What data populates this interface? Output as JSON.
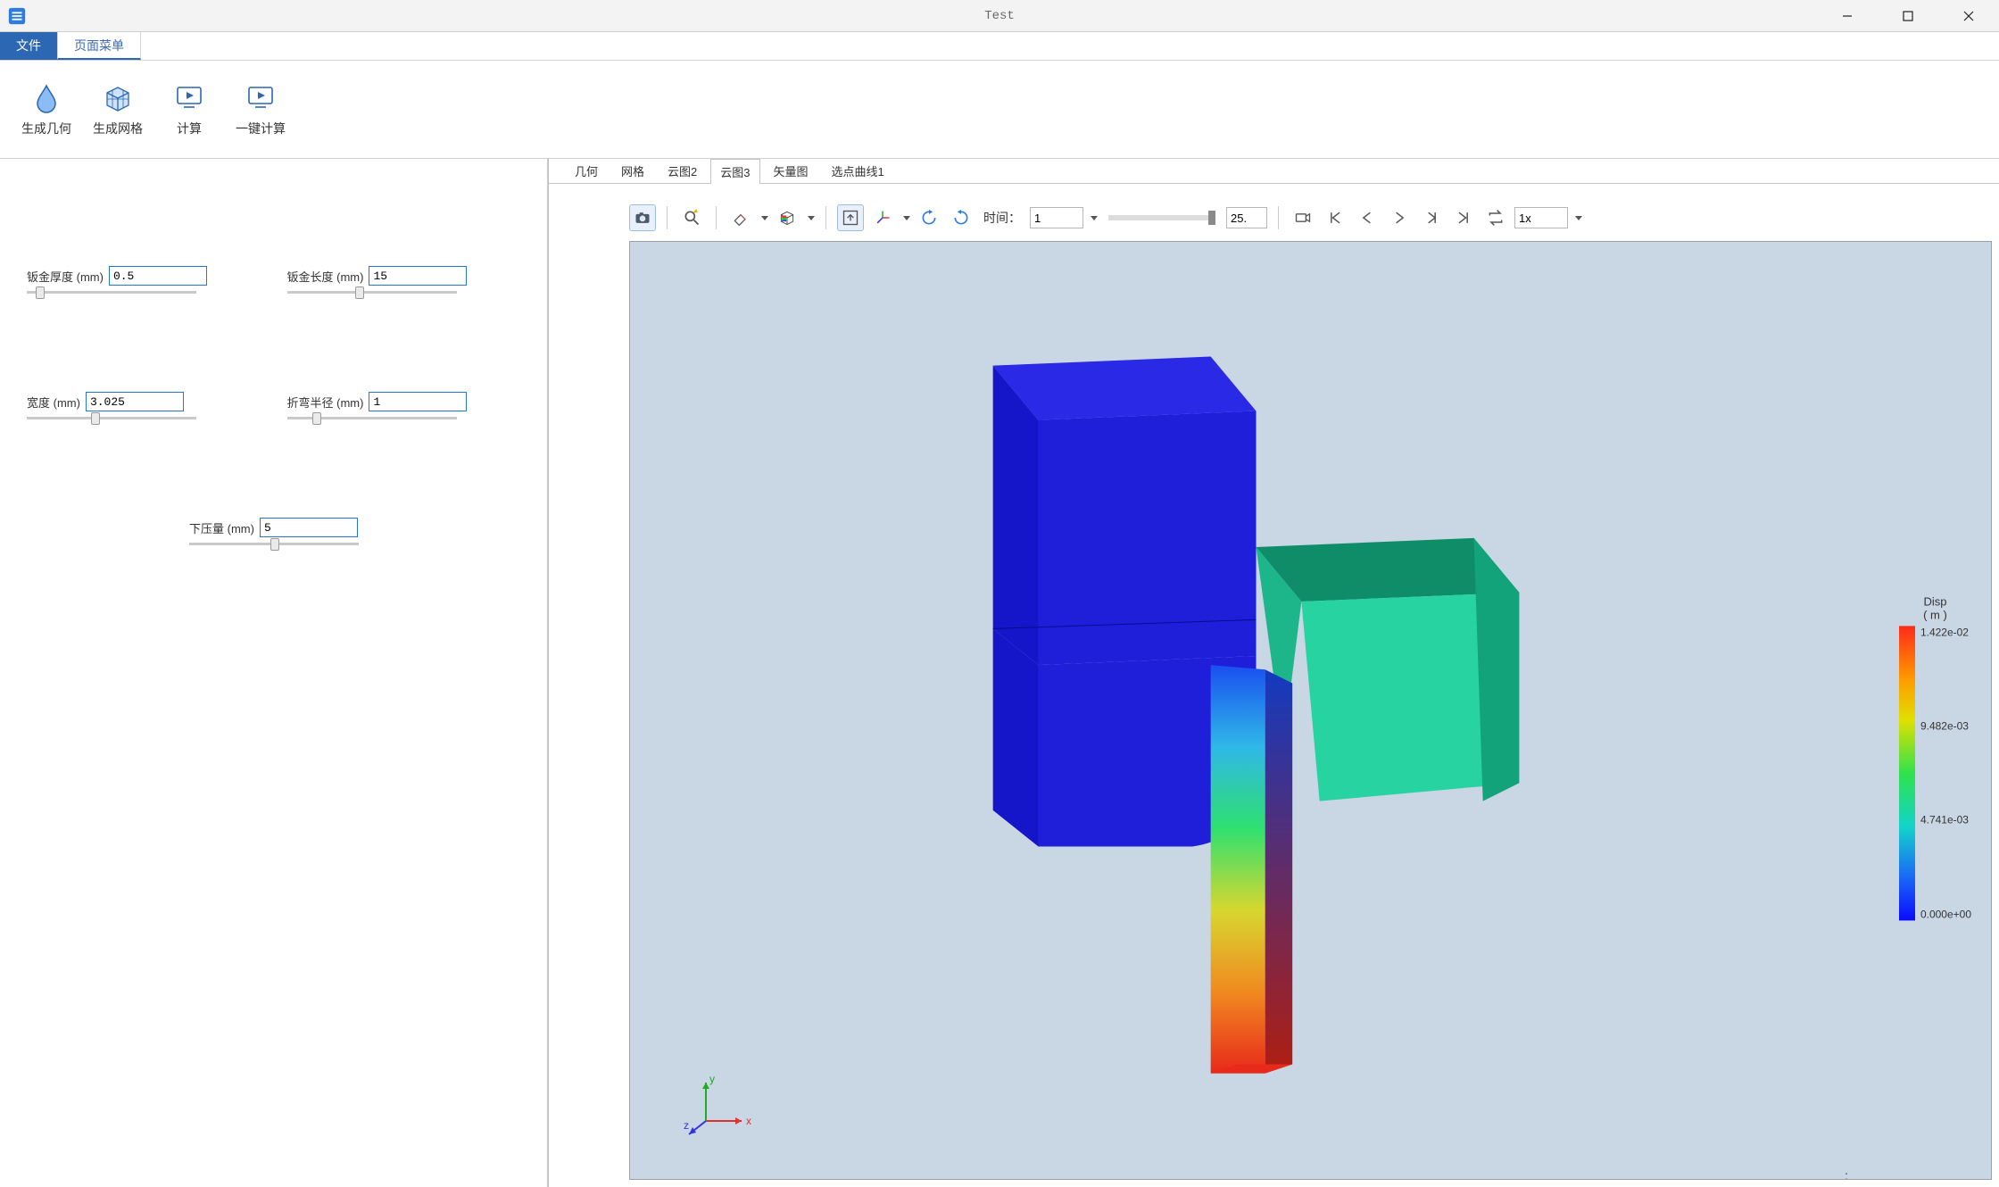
{
  "window": {
    "title": "Test"
  },
  "menu_tabs": {
    "file": "文件",
    "page_menu": "页面菜单"
  },
  "ribbon": {
    "gen_geometry": "生成几何",
    "gen_mesh": "生成网格",
    "compute": "计算",
    "one_click_compute": "一键计算"
  },
  "params": {
    "thickness": {
      "label": "钣金厚度 (mm)",
      "value": "0.5",
      "thumb_pct": 5
    },
    "length": {
      "label": "钣金长度 (mm)",
      "value": "15",
      "thumb_pct": 40
    },
    "width": {
      "label": "宽度 (mm)",
      "value": "3.025",
      "thumb_pct": 38
    },
    "bend_radius": {
      "label": "折弯半径 (mm)",
      "value": "1",
      "thumb_pct": 15
    },
    "press": {
      "label": "下压量 (mm)",
      "value": "5",
      "thumb_pct": 48
    }
  },
  "view_tabs": {
    "geometry": "几何",
    "mesh": "网格",
    "cloud2": "云图2",
    "cloud3": "云图3",
    "vector": "矢量图",
    "pick_curve": "选点曲线1"
  },
  "viewer_toolbar": {
    "time_label": "时间：",
    "frame": "1",
    "frame_end": "25.",
    "speed": "1x"
  },
  "legend": {
    "title_line1": "Disp",
    "title_line2": "( m )",
    "max": "1.422e-02",
    "t2": "9.482e-03",
    "t3": "4.741e-03",
    "min": "0.000e+00"
  },
  "triad": {
    "x": "x",
    "y": "y",
    "z": "z"
  },
  "status": ":"
}
